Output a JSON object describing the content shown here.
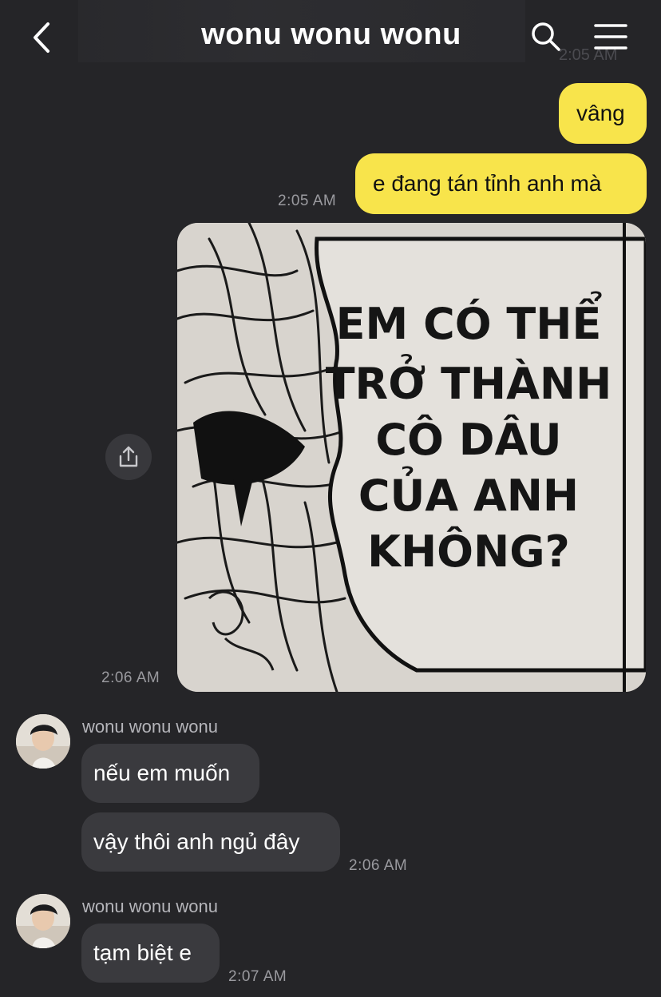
{
  "header": {
    "title": "wonu wonu wonu",
    "ghost_time": "2:05 AM"
  },
  "messages": {
    "out1": "vâng",
    "out2": "e đang tán tỉnh anh mà",
    "out2_time": "2:05 AM",
    "image_time": "2:06 AM",
    "manga_text": [
      "EM CÓ THỂ",
      "TRỞ THÀNH",
      "CÔ DÂU",
      "CỦA ANH",
      "KHÔNG?"
    ],
    "group1": {
      "sender": "wonu wonu wonu",
      "msg1": "nếu em muốn",
      "msg2": "vậy thôi anh ngủ đây",
      "time": "2:06 AM"
    },
    "group2": {
      "sender": "wonu wonu wonu",
      "msg1": "tạm biệt e",
      "time": "2:07 AM"
    }
  },
  "icons": {
    "back": "chevron-left-icon",
    "search": "search-icon",
    "menu": "hamburger-menu-icon",
    "share": "share-upload-icon"
  },
  "colors": {
    "background": "#252528",
    "outgoing_bubble": "#f8e44b",
    "incoming_bubble": "#3a3a3e",
    "timestamp": "#9a9a9f"
  }
}
